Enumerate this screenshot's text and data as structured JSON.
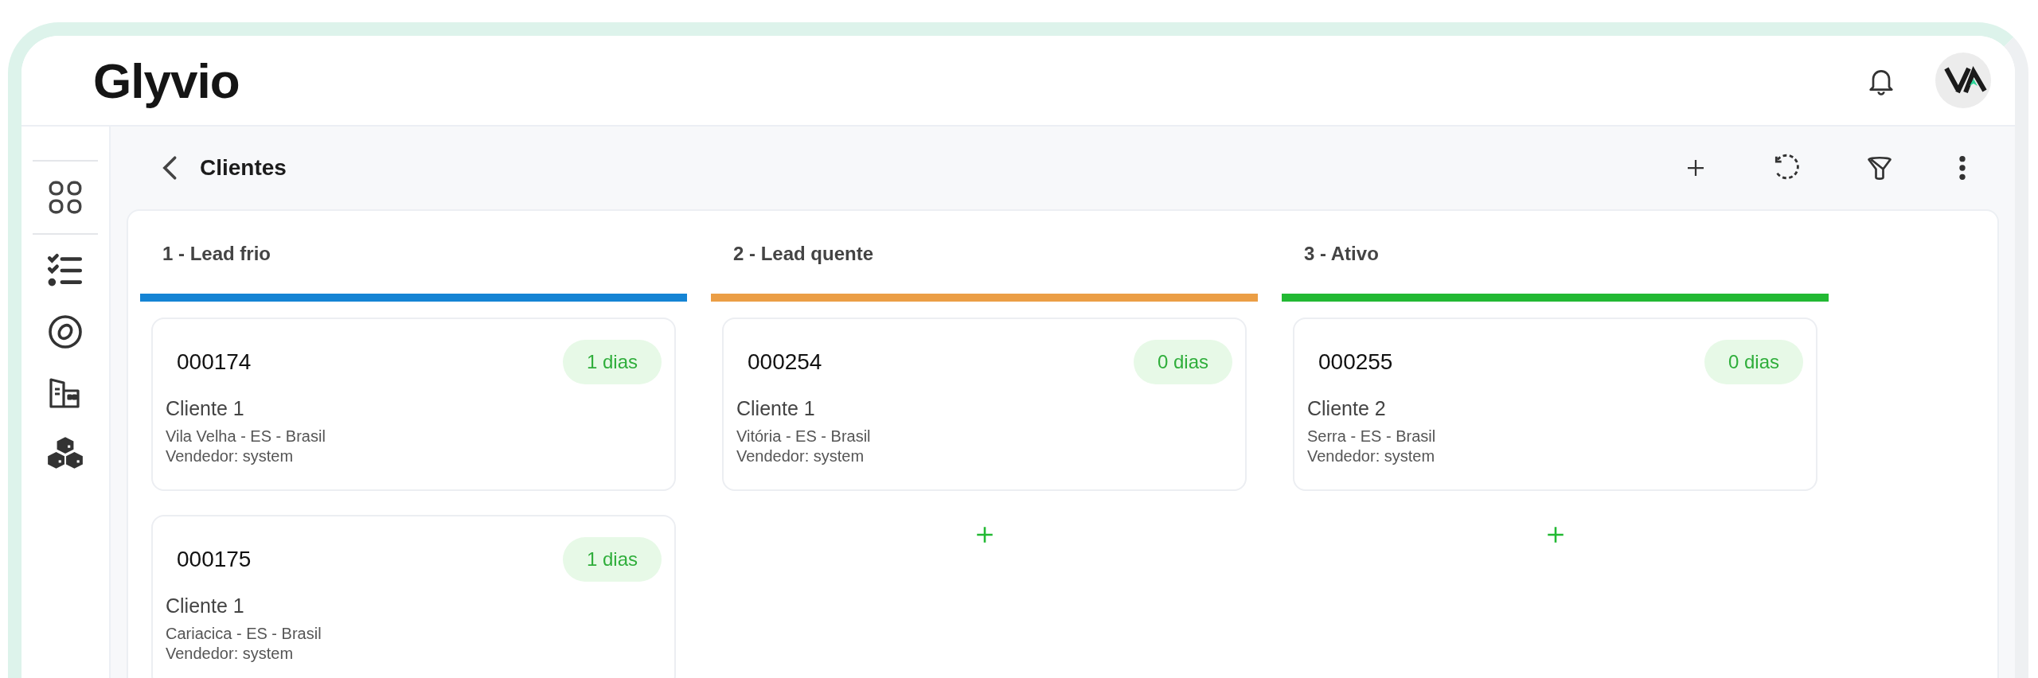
{
  "header": {
    "logo": "Glyvio"
  },
  "page": {
    "title": "Clientes"
  },
  "columns": [
    {
      "title": "1 - Lead frio",
      "color": "#1584d4",
      "cards": [
        {
          "number": "000174",
          "age": "1 dias",
          "client": "Cliente 1",
          "location": "Vila Velha - ES - Brasil",
          "seller": "Vendedor: system"
        },
        {
          "number": "000175",
          "age": "1 dias",
          "client": "Cliente 1",
          "location": "Cariacica - ES - Brasil",
          "seller": "Vendedor: system"
        }
      ]
    },
    {
      "title": "2 - Lead quente",
      "color": "#eb9e45",
      "cards": [
        {
          "number": "000254",
          "age": "0 dias",
          "client": "Cliente 1",
          "location": "Vitória - ES - Brasil",
          "seller": "Vendedor: system"
        }
      ]
    },
    {
      "title": "3 - Ativo",
      "color": "#22b933",
      "cards": [
        {
          "number": "000255",
          "age": "0 dias",
          "client": "Cliente 2",
          "location": "Serra - ES - Brasil",
          "seller": "Vendedor: system"
        }
      ]
    }
  ]
}
